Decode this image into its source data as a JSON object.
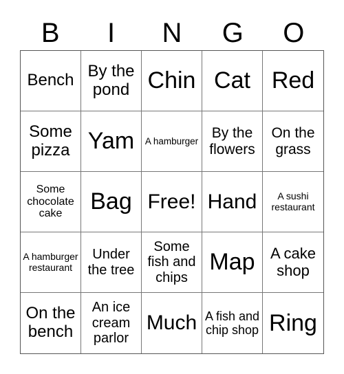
{
  "header": {
    "letters": [
      "B",
      "I",
      "N",
      "G",
      "O"
    ]
  },
  "grid": {
    "rows": [
      [
        "Bench",
        "By the pond",
        "Chin",
        "Cat",
        "Red"
      ],
      [
        "Some pizza",
        "Yam",
        "A hamburger",
        "By the flowers",
        "On the grass"
      ],
      [
        "Some chocolate cake",
        "Bag",
        "Free!",
        "Hand",
        "A sushi restaurant"
      ],
      [
        "A hamburger restaurant",
        "Under the tree",
        "Some fish and chips",
        "Map",
        "A cake shop"
      ],
      [
        "On the bench",
        "An ice cream parlor",
        "Much",
        "A fish and chip shop",
        "Ring"
      ]
    ],
    "free_space": "Free!"
  }
}
